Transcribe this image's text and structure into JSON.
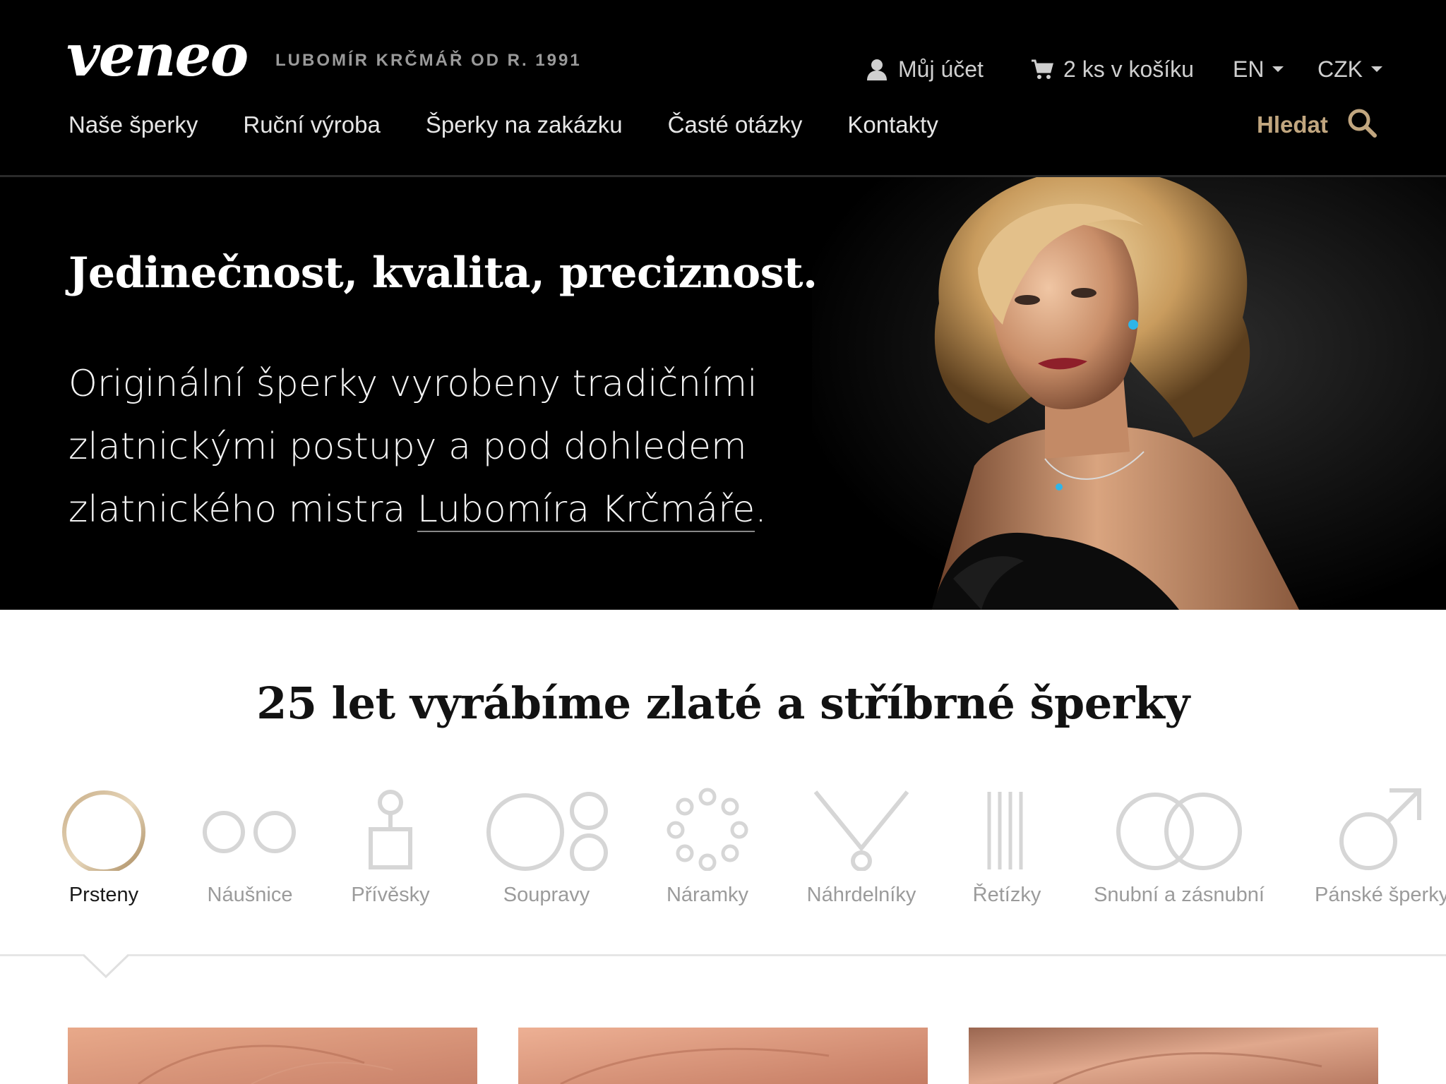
{
  "header": {
    "logo": "veneo",
    "tagline": "LUBOMÍR KRČMÁŘ OD R. 1991",
    "account_label": "Můj účet",
    "cart_label": "2 ks v košíku",
    "language": "EN",
    "currency": "CZK",
    "search_label": "Hledat",
    "nav": [
      {
        "label": "Naše šperky"
      },
      {
        "label": "Ruční výroba"
      },
      {
        "label": "Šperky na zakázku"
      },
      {
        "label": "Časté otázky"
      },
      {
        "label": "Kontakty"
      }
    ]
  },
  "hero": {
    "title": "Jedinečnost, kvalita, preciznost.",
    "text_line1": "Originální šperky vyrobeny tradičními",
    "text_line2": "zlatnickými postupy a pod dohledem",
    "text_line3_prefix": "zlatnického mistra ",
    "text_link": "Lubomíra Krčmáře",
    "text_line3_suffix": "."
  },
  "categories": {
    "title": "25 let vyrábíme zlaté a stříbrné šperky",
    "selected": "Prsteny",
    "items": [
      {
        "label": "Prsteny",
        "icon": "ring-icon"
      },
      {
        "label": "Náušnice",
        "icon": "earrings-icon"
      },
      {
        "label": "Přívěsky",
        "icon": "pendant-icon"
      },
      {
        "label": "Soupravy",
        "icon": "set-icon"
      },
      {
        "label": "Náramky",
        "icon": "bracelet-icon"
      },
      {
        "label": "Náhrdelníky",
        "icon": "necklace-icon"
      },
      {
        "label": "Řetízky",
        "icon": "chain-icon"
      },
      {
        "label": "Snubní a zásnubní",
        "icon": "wedding-rings-icon"
      },
      {
        "label": "Pánské šperky",
        "icon": "mens-jewelry-icon"
      }
    ]
  },
  "colors": {
    "header_bg": "#000000",
    "accent_gold": "#c1a67f",
    "icon_gray": "#d6d6d6",
    "text_dark": "#121212"
  }
}
